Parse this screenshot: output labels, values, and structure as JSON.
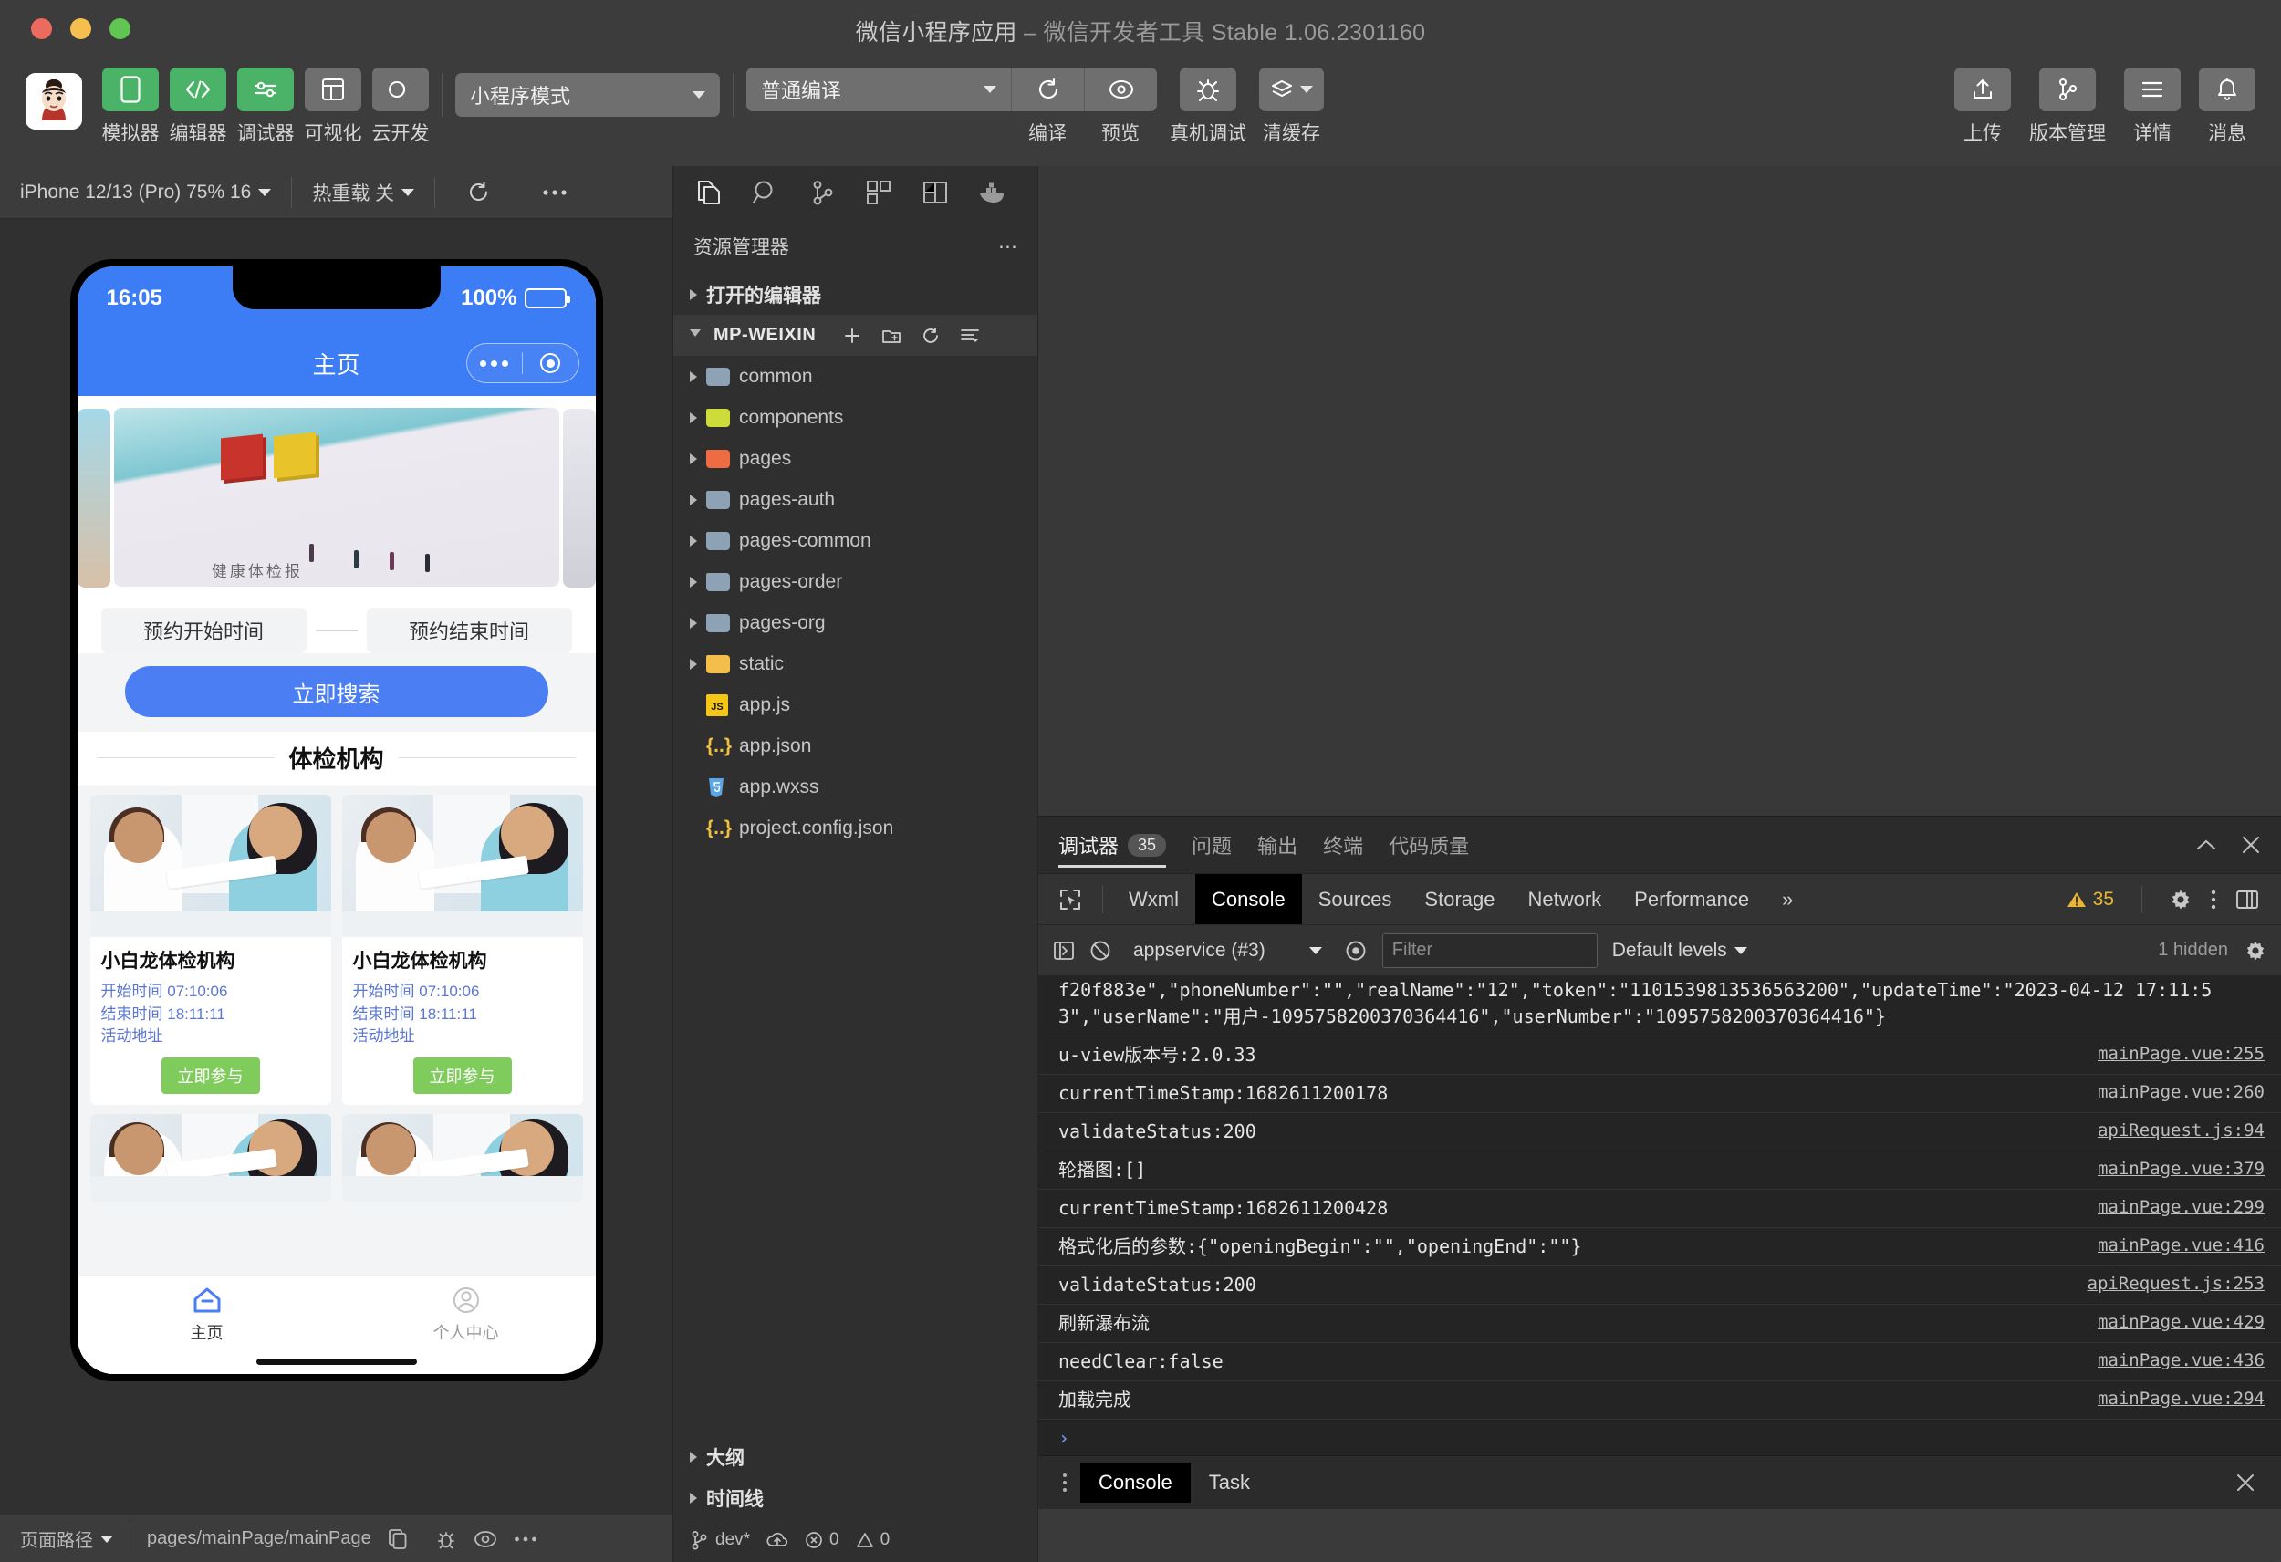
{
  "window": {
    "title_main": "微信小程序应用",
    "title_sep": " – ",
    "title_sub": "微信开发者工具 Stable 1.06.2301160"
  },
  "toolbar": {
    "buttons": [
      {
        "label": "模拟器",
        "icon": "phone-icon",
        "state": "green"
      },
      {
        "label": "编辑器",
        "icon": "code-icon",
        "state": "green"
      },
      {
        "label": "调试器",
        "icon": "sliders-icon",
        "state": "green"
      },
      {
        "label": "可视化",
        "icon": "layout-icon",
        "state": "grey"
      },
      {
        "label": "云开发",
        "icon": "cloud-icon",
        "state": "grey"
      }
    ],
    "mode_select": "小程序模式",
    "compile_select": "普通编译",
    "compile_label": "编译",
    "preview_label": "预览",
    "remote_debug_label": "真机调试",
    "clear_cache_label": "清缓存",
    "right_buttons": [
      {
        "label": "上传",
        "icon": "upload-icon"
      },
      {
        "label": "版本管理",
        "icon": "branch-icon"
      },
      {
        "label": "详情",
        "icon": "menu-icon"
      },
      {
        "label": "消息",
        "icon": "bell-icon"
      }
    ]
  },
  "simulator": {
    "device": "iPhone 12/13 (Pro) 75% 16",
    "hot_reload": "热重载 关",
    "refresh_icon": "refresh-icon",
    "more_icon": "more-icon",
    "status_time": "16:05",
    "battery_percent": "100%",
    "nav_title": "主页",
    "banner_text": "健康体检报",
    "search": {
      "start_placeholder": "预约开始时间",
      "end_placeholder": "预约结束时间",
      "button": "立即搜索"
    },
    "section_title": "体检机构",
    "cards": [
      {
        "name": "小白龙体检机构",
        "start_label": "开始时间",
        "start_value": "07:10:06",
        "end_label": "结束时间",
        "end_value": "18:11:11",
        "address": "活动地址",
        "join": "立即参与"
      },
      {
        "name": "小白龙体检机构",
        "start_label": "开始时间",
        "start_value": "07:10:06",
        "end_label": "结束时间",
        "end_value": "18:11:11",
        "address": "活动地址",
        "join": "立即参与"
      }
    ],
    "tabbar": [
      {
        "label": "主页",
        "icon": "home-icon",
        "active": true
      },
      {
        "label": "个人中心",
        "icon": "user-icon",
        "active": false
      }
    ],
    "footer": {
      "page_path_label": "页面路径",
      "page_path_value": "pages/mainPage/mainPage",
      "copy_icon": "copy-icon",
      "bug_icon": "bug-icon",
      "eye_icon": "eye-icon",
      "more_icon": "more-icon"
    }
  },
  "explorer": {
    "icons": [
      "files-icon",
      "search-icon",
      "source-control-icon",
      "extensions-icon",
      "split-icon",
      "docker-icon"
    ],
    "header": "资源管理器",
    "header_more": "⋯",
    "open_editors": "打开的编辑器",
    "project_name": "MP-WEIXIN",
    "project_actions": [
      "new-file-icon",
      "new-folder-icon",
      "refresh-icon",
      "collapse-icon"
    ],
    "tree": [
      {
        "label": "common",
        "type": "folder",
        "color": "blue"
      },
      {
        "label": "components",
        "type": "folder",
        "color": "lime"
      },
      {
        "label": "pages",
        "type": "folder",
        "color": "orange"
      },
      {
        "label": "pages-auth",
        "type": "folder",
        "color": "blue"
      },
      {
        "label": "pages-common",
        "type": "folder",
        "color": "blue"
      },
      {
        "label": "pages-order",
        "type": "folder",
        "color": "blue"
      },
      {
        "label": "pages-org",
        "type": "folder",
        "color": "blue"
      },
      {
        "label": "static",
        "type": "folder",
        "color": "amber"
      },
      {
        "label": "app.js",
        "type": "file",
        "icon": "js-icon"
      },
      {
        "label": "app.json",
        "type": "file",
        "icon": "json-icon"
      },
      {
        "label": "app.wxss",
        "type": "file",
        "icon": "css-icon"
      },
      {
        "label": "project.config.json",
        "type": "file",
        "icon": "json-icon"
      }
    ],
    "outline": "大纲",
    "timeline": "时间线",
    "status": {
      "branch": "dev*",
      "sync_icon": "sync-icon",
      "errors": "0",
      "warnings": "0"
    }
  },
  "devtools": {
    "panel_tabs": [
      {
        "label": "调试器",
        "badge": "35",
        "active": true
      },
      {
        "label": "问题",
        "badge": "",
        "active": false
      },
      {
        "label": "输出",
        "badge": "",
        "active": false
      },
      {
        "label": "终端",
        "badge": "",
        "active": false
      },
      {
        "label": "代码质量",
        "badge": "",
        "active": false
      }
    ],
    "panel_collapse_icon": "chevron-up-icon",
    "panel_close_icon": "close-icon",
    "inspector_icon": "inspect-icon",
    "tabs": [
      {
        "label": "Wxml",
        "active": false
      },
      {
        "label": "Console",
        "active": true
      },
      {
        "label": "Sources",
        "active": false
      },
      {
        "label": "Storage",
        "active": false
      },
      {
        "label": "Network",
        "active": false
      },
      {
        "label": "Performance",
        "active": false
      }
    ],
    "overflow": "»",
    "warning_count": "35",
    "settings_icon": "gear-icon",
    "kebab_icon": "kebab-icon",
    "dock_icon": "dock-icon",
    "console_bar": {
      "sidebar_icon": "console-sidebar-icon",
      "clear_icon": "clear-icon",
      "context": "appservice (#3)",
      "eye_icon": "eye-icon",
      "filter_placeholder": "Filter",
      "levels": "Default levels",
      "hidden": "1 hidden",
      "settings_icon": "gear-icon"
    },
    "logs": [
      {
        "msg": "f20f883e\",\"phoneNumber\":\"\",\"realName\":\"12\",\"token\":\"1101539813536563200\",\"updateTime\":\"2023-04-12 17:11:53\",\"userName\":\"用户-1095758200370364416\",\"userNumber\":\"1095758200370364416\"}",
        "src": ""
      },
      {
        "msg": "u-view版本号:2.0.33",
        "src": "mainPage.vue:255"
      },
      {
        "msg": "currentTimeStamp:1682611200178",
        "src": "mainPage.vue:260"
      },
      {
        "msg": "validateStatus:200",
        "src": "apiRequest.js:94"
      },
      {
        "msg": "轮播图:[]",
        "src": "mainPage.vue:379"
      },
      {
        "msg": "currentTimeStamp:1682611200428",
        "src": "mainPage.vue:299"
      },
      {
        "msg": "格式化后的参数:{\"openingBegin\":\"\",\"openingEnd\":\"\"}",
        "src": "mainPage.vue:416"
      },
      {
        "msg": "validateStatus:200",
        "src": "apiRequest.js:253"
      },
      {
        "msg": "刷新瀑布流",
        "src": "mainPage.vue:429"
      },
      {
        "msg": "needClear:false",
        "src": "mainPage.vue:436"
      },
      {
        "msg": "加载完成",
        "src": "mainPage.vue:294"
      }
    ],
    "prompt": "›",
    "drawer": {
      "tabs": [
        {
          "label": "Console",
          "active": true
        },
        {
          "label": "Task",
          "active": false
        }
      ],
      "close_icon": "close-icon"
    }
  },
  "colors": {
    "accent_green": "#4ab367",
    "accent_blue": "#3c7cf5",
    "warning": "#e8b634",
    "card_join": "#7fcb5c"
  }
}
